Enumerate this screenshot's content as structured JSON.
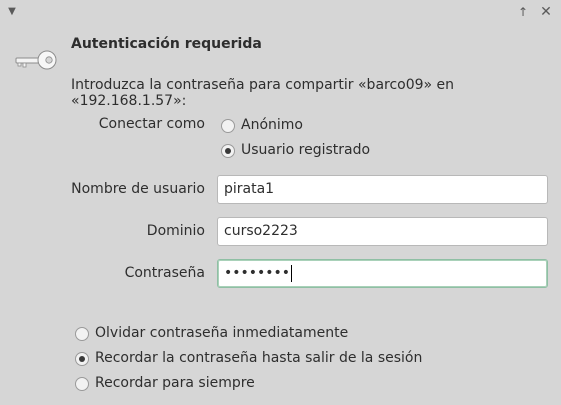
{
  "titlebar": {
    "menu_icon": "chevron-down-icon",
    "up_icon": "arrow-up-icon",
    "close_icon": "close-icon"
  },
  "dialog": {
    "icon": "key-icon",
    "heading": "Autenticación requerida",
    "intro": "Introduzca la contraseña para compartir «barco09» en «192.168.1.57»:"
  },
  "connect_as": {
    "label": "Conectar como",
    "options": [
      {
        "label": "Anónimo",
        "selected": false
      },
      {
        "label": "Usuario registrado",
        "selected": true
      }
    ]
  },
  "fields": {
    "username": {
      "label": "Nombre de usuario",
      "value": "pirata1"
    },
    "domain": {
      "label": "Dominio",
      "value": "curso2223"
    },
    "password": {
      "label": "Contraseña",
      "value": "••••••••"
    }
  },
  "remember": {
    "options": [
      {
        "label": "Olvidar contraseña inmediatamente",
        "selected": false
      },
      {
        "label": "Recordar la contraseña hasta salir de la sesión",
        "selected": true
      },
      {
        "label": "Recordar para siempre",
        "selected": false
      }
    ]
  },
  "colors": {
    "background": "#d6d6d6",
    "focus_border": "#8fbfa4"
  }
}
